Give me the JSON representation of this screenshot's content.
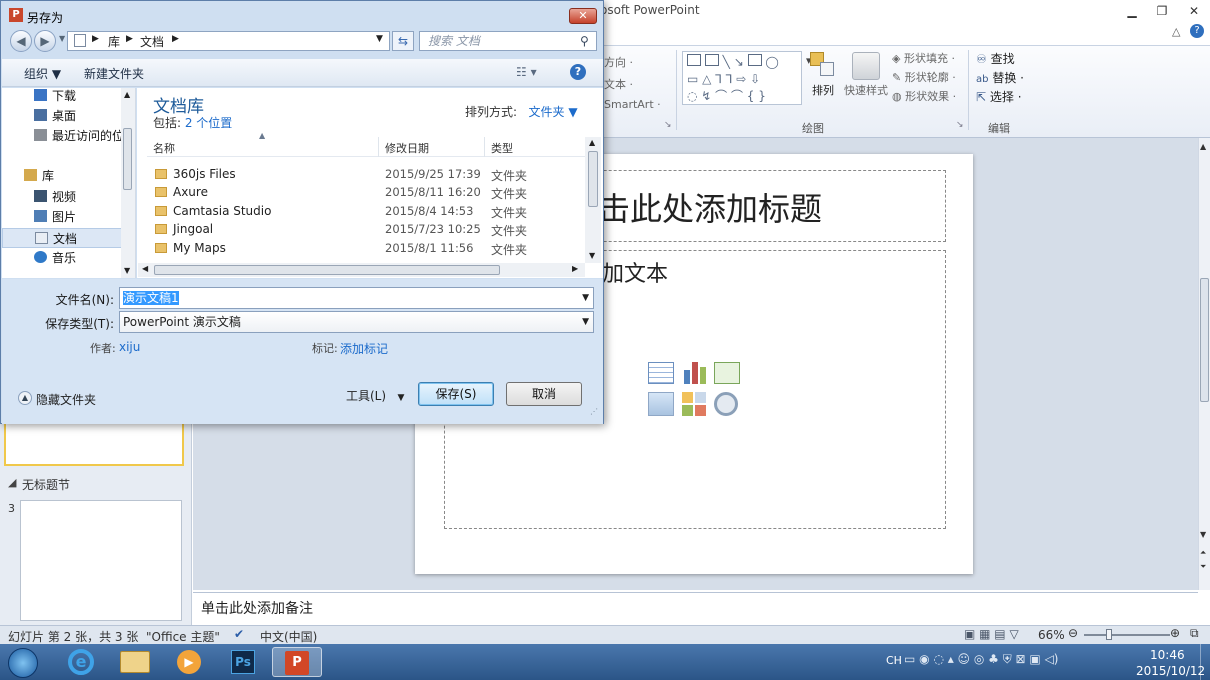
{
  "ppt": {
    "title": "osoft PowerPoint",
    "ribbon": {
      "partial1": "方向 ·",
      "partial2": "文本 ·",
      "partial3": "SmartArt ·",
      "arrange": "排列",
      "quick_styles": "快速样式",
      "shape_fill": "形状填充 ·",
      "shape_outline": "形状轮廓 ·",
      "shape_effects": "形状效果 ·",
      "find": "查找",
      "replace": "替换 ·",
      "select": "选择 ·",
      "group_drawing": "绘图",
      "group_editing": "编辑"
    },
    "thumb_section": "无标题节",
    "thumb_num": "3",
    "slide": {
      "title_placeholder": "击此处添加标题",
      "body_placeholder": "加文本"
    },
    "notes": "单击此处添加备注",
    "status": {
      "slide_info": "幻灯片 第 2 张，共 3 张",
      "theme": "\"Office 主题\"",
      "language": "中文(中国)",
      "zoom": "66%"
    },
    "taskbar": {
      "ime": "CH",
      "time": "10:46",
      "date": "2015/10/12"
    }
  },
  "dialog": {
    "title": "另存为",
    "breadcrumb": [
      "库",
      "文档"
    ],
    "search_placeholder": "搜索 文档",
    "organize": "组织 ▼",
    "new_folder": "新建文件夹",
    "nav": [
      {
        "label": "下载",
        "icon": "download-folder-icon",
        "color": "#3a74c4"
      },
      {
        "label": "桌面",
        "icon": "desktop-icon",
        "color": "#4a6fa0"
      },
      {
        "label": "最近访问的位置",
        "icon": "recent-places-icon",
        "color": "#8a8f96"
      },
      {
        "label": "库",
        "icon": "library-icon",
        "color": "#d4a94d"
      },
      {
        "label": "视频",
        "icon": "video-library-icon",
        "color": "#3b5470"
      },
      {
        "label": "图片",
        "icon": "pictures-library-icon",
        "color": "#4f7eb5"
      },
      {
        "label": "文档",
        "icon": "documents-library-icon",
        "color": "#e9eef5"
      },
      {
        "label": "音乐",
        "icon": "music-library-icon",
        "color": "#2f79c8"
      }
    ],
    "library_title": "文档库",
    "library_includes_label": "包括: ",
    "library_includes_link": "2 个位置",
    "sort_label": "排列方式:",
    "sort_value": "文件夹 ▼",
    "columns": {
      "name": "名称",
      "date": "修改日期",
      "type": "类型"
    },
    "files": [
      {
        "name": "360js Files",
        "date": "2015/9/25 17:39",
        "type": "文件夹"
      },
      {
        "name": "Axure",
        "date": "2015/8/11 16:20",
        "type": "文件夹"
      },
      {
        "name": "Camtasia Studio",
        "date": "2015/8/4 14:53",
        "type": "文件夹"
      },
      {
        "name": "Jingoal",
        "date": "2015/7/23 10:25",
        "type": "文件夹"
      },
      {
        "name": "My Maps",
        "date": "2015/8/1 11:56",
        "type": "文件夹"
      }
    ],
    "filename_label": "文件名(N):",
    "filename_value": "演示文稿1",
    "filetype_label": "保存类型(T):",
    "filetype_value": "PowerPoint 演示文稿",
    "author_label": "作者:",
    "author_value": "xiju",
    "tags_label": "标记:",
    "tags_value": "添加标记",
    "hide_folders": "隐藏文件夹",
    "tools": "工具(L)",
    "save": "保存(S)",
    "cancel": "取消"
  }
}
